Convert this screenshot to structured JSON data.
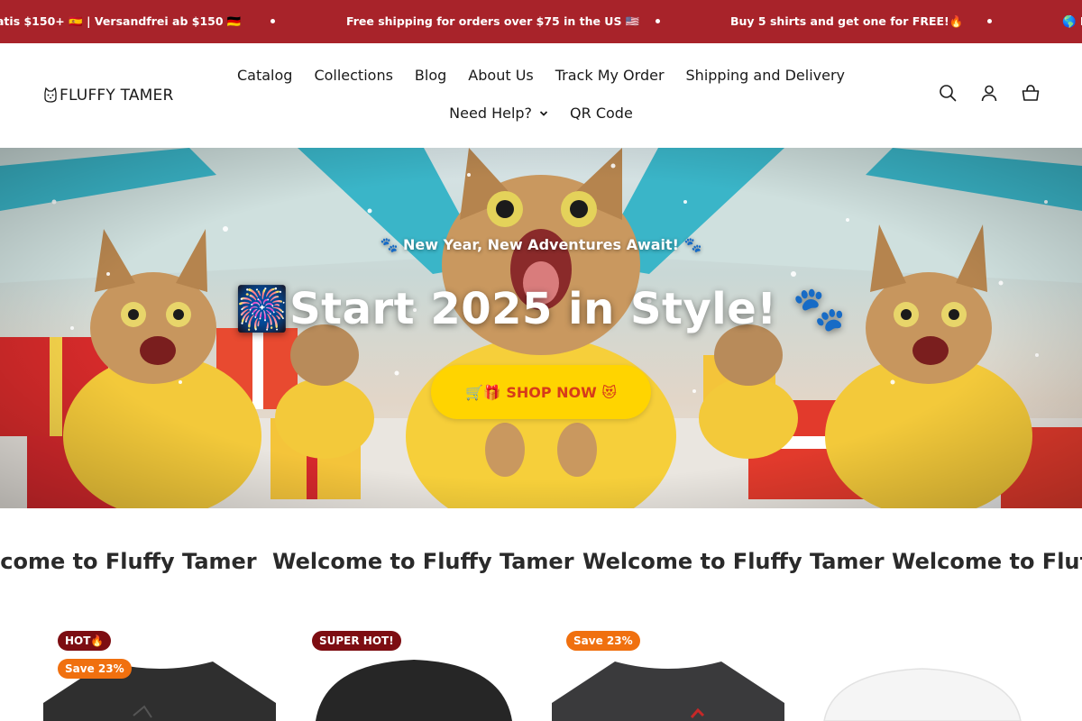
{
  "colors": {
    "announcement_bg": "#a8232a",
    "button_bg": "#ffd400",
    "button_text": "#d63a1a",
    "badge_hot": "#7d0d12",
    "badge_save": "#f0700f"
  },
  "announcement": {
    "items": [
      "atis $150+ 🇪🇸 | Versandfrei ab $150 🇩🇪",
      "Free shipping for orders over $75 in the US 🇺🇸",
      "Buy 5 shirts and get one for FREE!🔥",
      "🌎 I"
    ]
  },
  "header": {
    "logo_text": "FLUFFY TAMER",
    "nav": [
      "Catalog",
      "Collections",
      "Blog",
      "About Us",
      "Track My Order",
      "Shipping and Delivery",
      "Need Help?",
      "QR Code"
    ],
    "icons": [
      "search-icon",
      "account-icon",
      "cart-icon"
    ]
  },
  "hero": {
    "subtitle": "🐾 New Year, New Adventures Await! 🐾",
    "title": "🎆Start 2025 in Style! 🐾",
    "button_label": "🛒🎁 SHOP NOW 😻"
  },
  "marquee": {
    "items": [
      "lcome to Fluffy Tamer",
      "Welcome to Fluffy Tamer",
      "Welcome to Fluffy Tamer",
      "Welcome to Fluffy T"
    ]
  },
  "products": [
    {
      "badges": [
        "HOT🔥",
        "Save 23%"
      ]
    },
    {
      "badges": [
        "SUPER HOT!"
      ]
    },
    {
      "badges": [
        "Save 23%"
      ]
    },
    {
      "badges": []
    }
  ]
}
